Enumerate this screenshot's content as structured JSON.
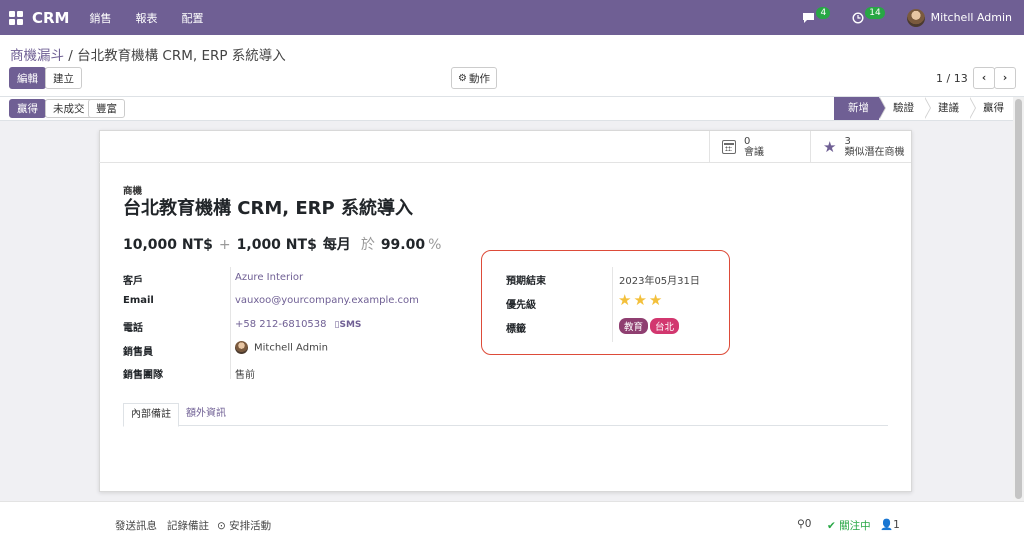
{
  "navbar": {
    "brand": "CRM",
    "menu": [
      "銷售",
      "報表",
      "配置"
    ],
    "messages_count": "4",
    "activities_count": "14",
    "user_name": "Mitchell Admin",
    "color": "#6f5f94"
  },
  "control": {
    "breadcrumb_parent": "商機漏斗",
    "breadcrumb_sep": " / ",
    "breadcrumb_current": "台北教育機構 CRM, ERP 系統導入",
    "edit_label": "編輯",
    "create_label": "建立",
    "action_label": "動作",
    "pager": "1 / 13"
  },
  "status": {
    "buttons": [
      "贏得",
      "未成交",
      "豐富"
    ],
    "stages": [
      "新增",
      "驗證",
      "建議",
      "贏得"
    ],
    "active_stage": "新增"
  },
  "smart_buttons": {
    "meetings_count": "0",
    "meetings_label": "會議",
    "similar_count": "3",
    "similar_label": "類似潛在商機"
  },
  "record": {
    "type_label": "商機",
    "name": "台北教育機構 CRM, ERP 系統導入",
    "expected_revenue": "10,000 NT$",
    "plus": "+",
    "recurring_revenue": "1,000 NT$",
    "recurring_plan": "每月",
    "at_label": "於",
    "probability": "99.00",
    "percent_sign": "%"
  },
  "fields": {
    "customer_label": "客戶",
    "customer": "Azure Interior",
    "email_label": "Email",
    "email": "vauxoo@yourcompany.example.com",
    "phone_label": "電話",
    "phone": "+58 212-6810538",
    "sms_label": "SMS",
    "salesperson_label": "銷售員",
    "salesperson": "Mitchell Admin",
    "team_label": "銷售團隊",
    "team": "售前",
    "deadline_label": "預期結束",
    "deadline": "2023年05月31日",
    "priority_label": "優先級",
    "priority_stars": "★★★",
    "priority_value": 3,
    "tags_label": "標籤",
    "tags": [
      {
        "name": "教育",
        "color": "#8f3f71"
      },
      {
        "name": "台北",
        "color": "#d2376f"
      }
    ]
  },
  "tabs": [
    "內部備註",
    "額外資訊"
  ],
  "chatter": {
    "send_message": "發送訊息",
    "log_note": "記錄備註",
    "schedule_activity": "安排活動",
    "attachments_count": "0",
    "following_label": "關注中",
    "followers_count": "1"
  }
}
